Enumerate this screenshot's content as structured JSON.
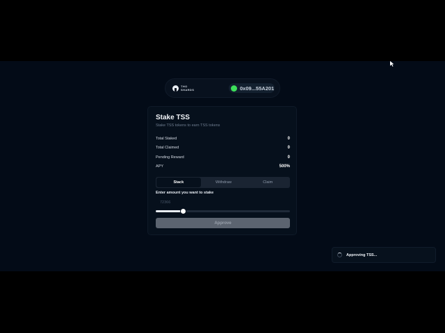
{
  "brand": {
    "logo_line1": "THO",
    "logo_line2": "SHARDS"
  },
  "wallet": {
    "address": "0x09...55A201",
    "status_color": "#3de05a"
  },
  "card": {
    "title": "Stake TSS",
    "subtitle": "Stake TSS tokens to earn TSS tokens",
    "stats": [
      {
        "label": "Total Staked",
        "value": "0"
      },
      {
        "label": "Total Claimed",
        "value": "0"
      },
      {
        "label": "Pending Reward",
        "value": "0"
      },
      {
        "label": "APY",
        "value": "500%"
      }
    ],
    "tabs": [
      {
        "label": "Stack",
        "active": true
      },
      {
        "label": "Withdraw",
        "active": false
      },
      {
        "label": "Claim",
        "active": false
      }
    ],
    "amount_label": "Enter amount you want to stake",
    "amount_value": "72366",
    "slider_fraction": 0.2,
    "approve_label": "Approve"
  },
  "toast": {
    "text": "Approving TSS..."
  }
}
